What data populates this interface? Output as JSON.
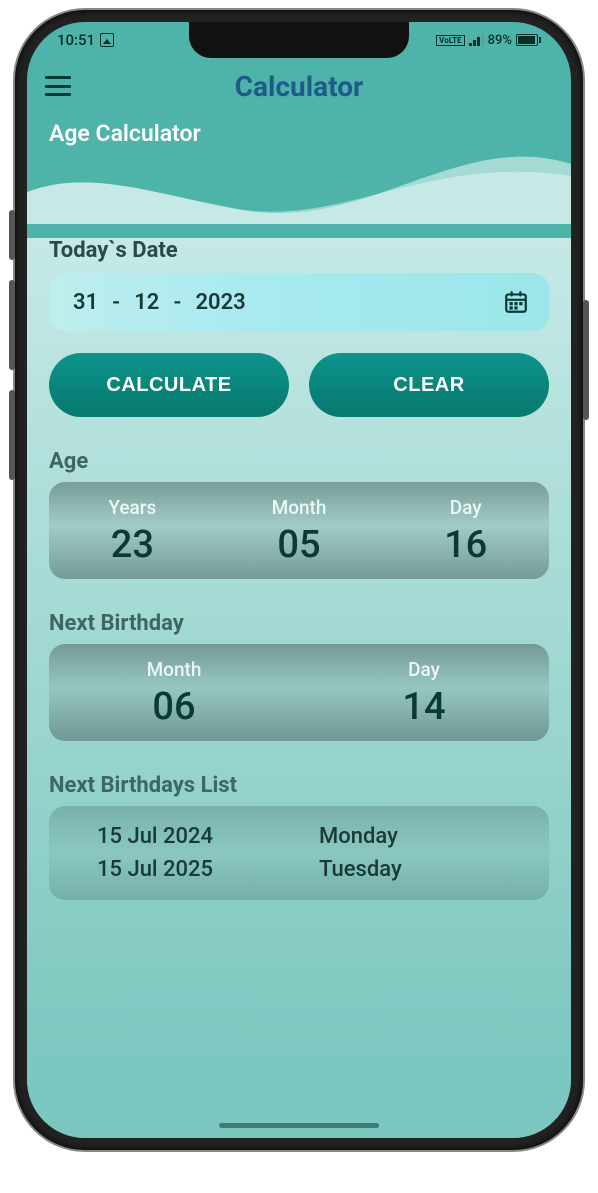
{
  "status": {
    "time": "10:51",
    "volte": "VoLTE",
    "battery_pct": "89%"
  },
  "header": {
    "title": "Calculator"
  },
  "section": {
    "title": "Age Calculator"
  },
  "todays_date": {
    "label": "Today`s Date",
    "day": "31",
    "month": "12",
    "year": "2023"
  },
  "buttons": {
    "calculate": "CALCULATE",
    "clear": "CLEAR"
  },
  "age": {
    "label": "Age",
    "years_hdr": "Years",
    "month_hdr": "Month",
    "day_hdr": "Day",
    "years": "23",
    "month": "05",
    "day": "16"
  },
  "next_birthday": {
    "label": "Next Birthday",
    "month_hdr": "Month",
    "day_hdr": "Day",
    "month": "06",
    "day": "14"
  },
  "next_list": {
    "label": "Next Birthdays List",
    "rows": [
      {
        "date": "15  Jul  2024",
        "day": "Monday"
      },
      {
        "date": "15  Jul  2025",
        "day": "Tuesday"
      }
    ]
  }
}
